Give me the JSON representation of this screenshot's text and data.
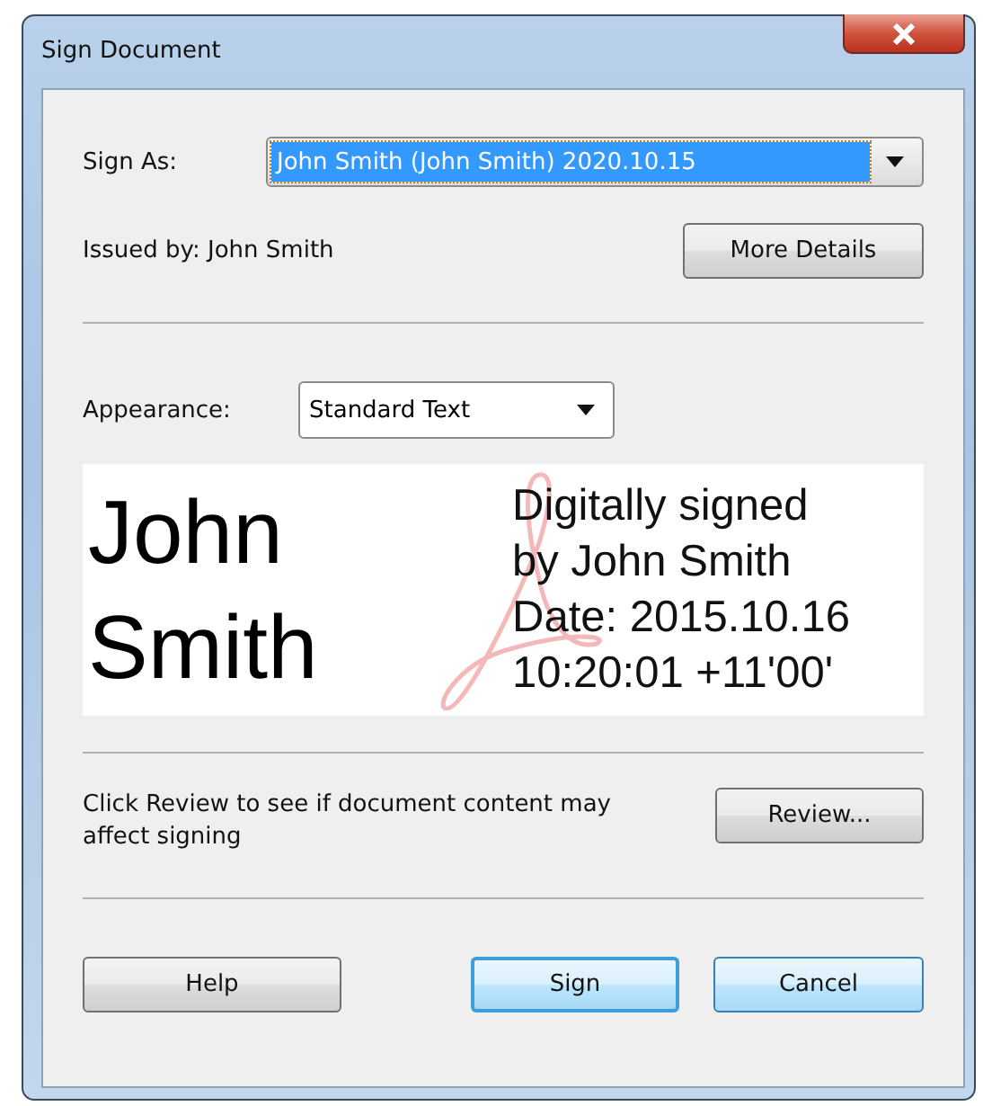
{
  "window": {
    "title": "Sign Document"
  },
  "sign_as": {
    "label": "Sign As:",
    "value": "John Smith (John Smith) 2020.10.15",
    "selected": true
  },
  "issued_by": "Issued by: John Smith",
  "more_details_button": "More Details",
  "appearance": {
    "label": "Appearance:",
    "value": "Standard Text"
  },
  "preview": {
    "name_lines": [
      "John",
      "Smith"
    ],
    "detail_lines": [
      "Digitally signed",
      "by John Smith",
      "Date: 2015.10.16",
      "10:20:01 +11'00'"
    ]
  },
  "review": {
    "text": "Click Review to see if document content may affect signing",
    "button": "Review..."
  },
  "buttons": [
    {
      "label": "Help",
      "highlighted": false,
      "default": false
    },
    {
      "label": "Sign",
      "highlighted": true,
      "default": true
    },
    {
      "label": "Cancel",
      "highlighted": true,
      "default": false
    }
  ]
}
